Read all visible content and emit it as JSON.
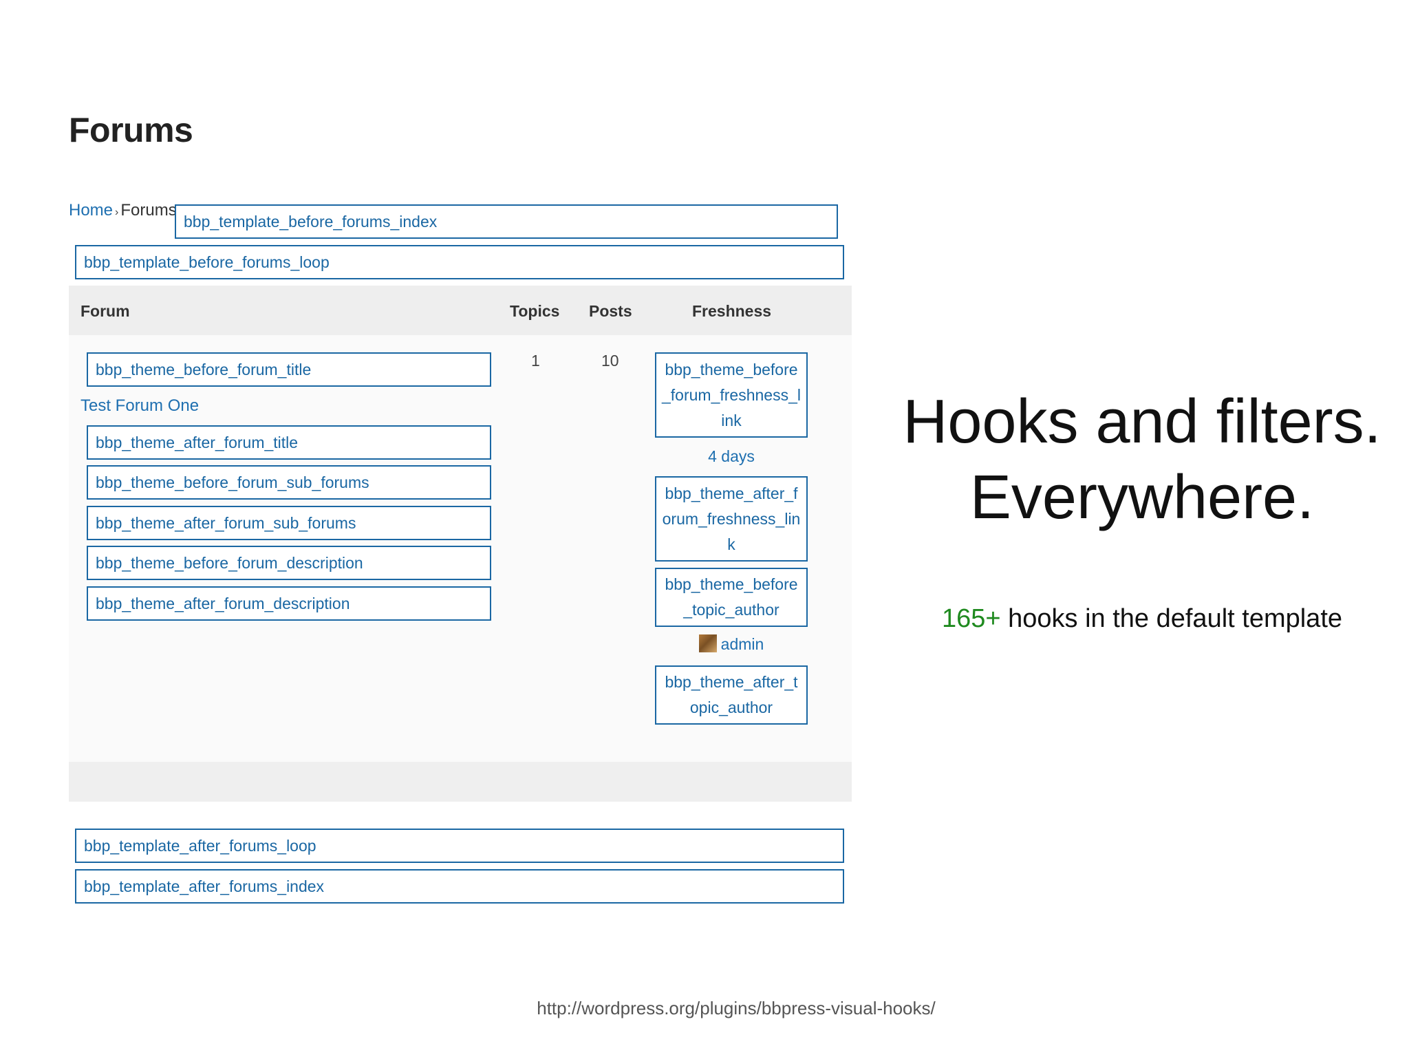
{
  "page_title": "Forums",
  "breadcrumb": {
    "home": "Home",
    "separator": "›",
    "current": "Forums"
  },
  "hooks": {
    "before_forums_index": "bbp_template_before_forums_index",
    "before_forums_loop": "bbp_template_before_forums_loop",
    "before_forum_title": "bbp_theme_before_forum_title",
    "after_forum_title": "bbp_theme_after_forum_title",
    "before_forum_sub_forums": "bbp_theme_before_forum_sub_forums",
    "after_forum_sub_forums": "bbp_theme_after_forum_sub_forums",
    "before_forum_description": "bbp_theme_before_forum_description",
    "after_forum_description": "bbp_theme_after_forum_description",
    "before_forum_freshness_link": "bbp_theme_before_forum_freshness_link",
    "after_forum_freshness_link": "bbp_theme_after_forum_freshness_link",
    "before_topic_author": "bbp_theme_before_topic_author",
    "after_topic_author": "bbp_theme_after_topic_author",
    "after_forums_loop": "bbp_template_after_forums_loop",
    "after_forums_index": "bbp_template_after_forums_index"
  },
  "table": {
    "headers": {
      "forum": "Forum",
      "topics": "Topics",
      "posts": "Posts",
      "freshness": "Freshness"
    },
    "row": {
      "forum_name": "Test Forum One",
      "topics": "1",
      "posts": "10",
      "freshness": "4 days",
      "author": "admin"
    }
  },
  "headline": {
    "line1": "Hooks and filters.",
    "line2": "Everywhere."
  },
  "subline": {
    "count": "165+",
    "text": " hooks in the default template"
  },
  "source_url": "http://wordpress.org/plugins/bbpress-visual-hooks/"
}
